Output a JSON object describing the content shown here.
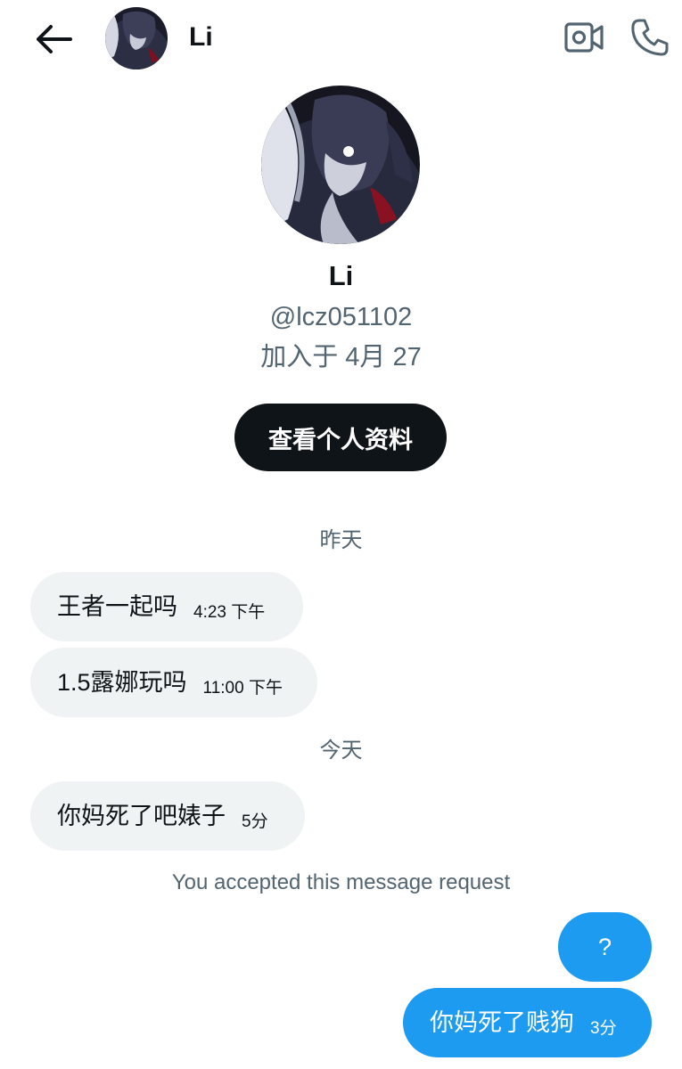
{
  "header": {
    "back_icon": "back-arrow-icon",
    "name": "Li",
    "video_icon": "video-call-icon",
    "phone_icon": "phone-icon"
  },
  "profile": {
    "name": "Li",
    "handle": "@lcz051102",
    "joined": "加入于 4月 27",
    "view_profile_label": "查看个人资料"
  },
  "conversation": {
    "date_yesterday": "昨天",
    "date_today": "今天",
    "messages": [
      {
        "text": "王者一起吗",
        "time": "4:23 下午",
        "direction": "in"
      },
      {
        "text": "1.5露娜玩吗",
        "time": "11:00 下午",
        "direction": "in"
      },
      {
        "text": "你妈死了吧婊子",
        "time": "5分",
        "direction": "in"
      },
      {
        "text": "?",
        "time": "",
        "direction": "out"
      },
      {
        "text": "你妈死了贱狗",
        "time": "3分",
        "direction": "out"
      }
    ],
    "accepted_notice": "You accepted this message request"
  },
  "colors": {
    "accent_blue": "#1d9bf0",
    "incoming_bubble": "#eff3f4",
    "secondary_text": "#536471",
    "primary_text": "#0f1419"
  }
}
